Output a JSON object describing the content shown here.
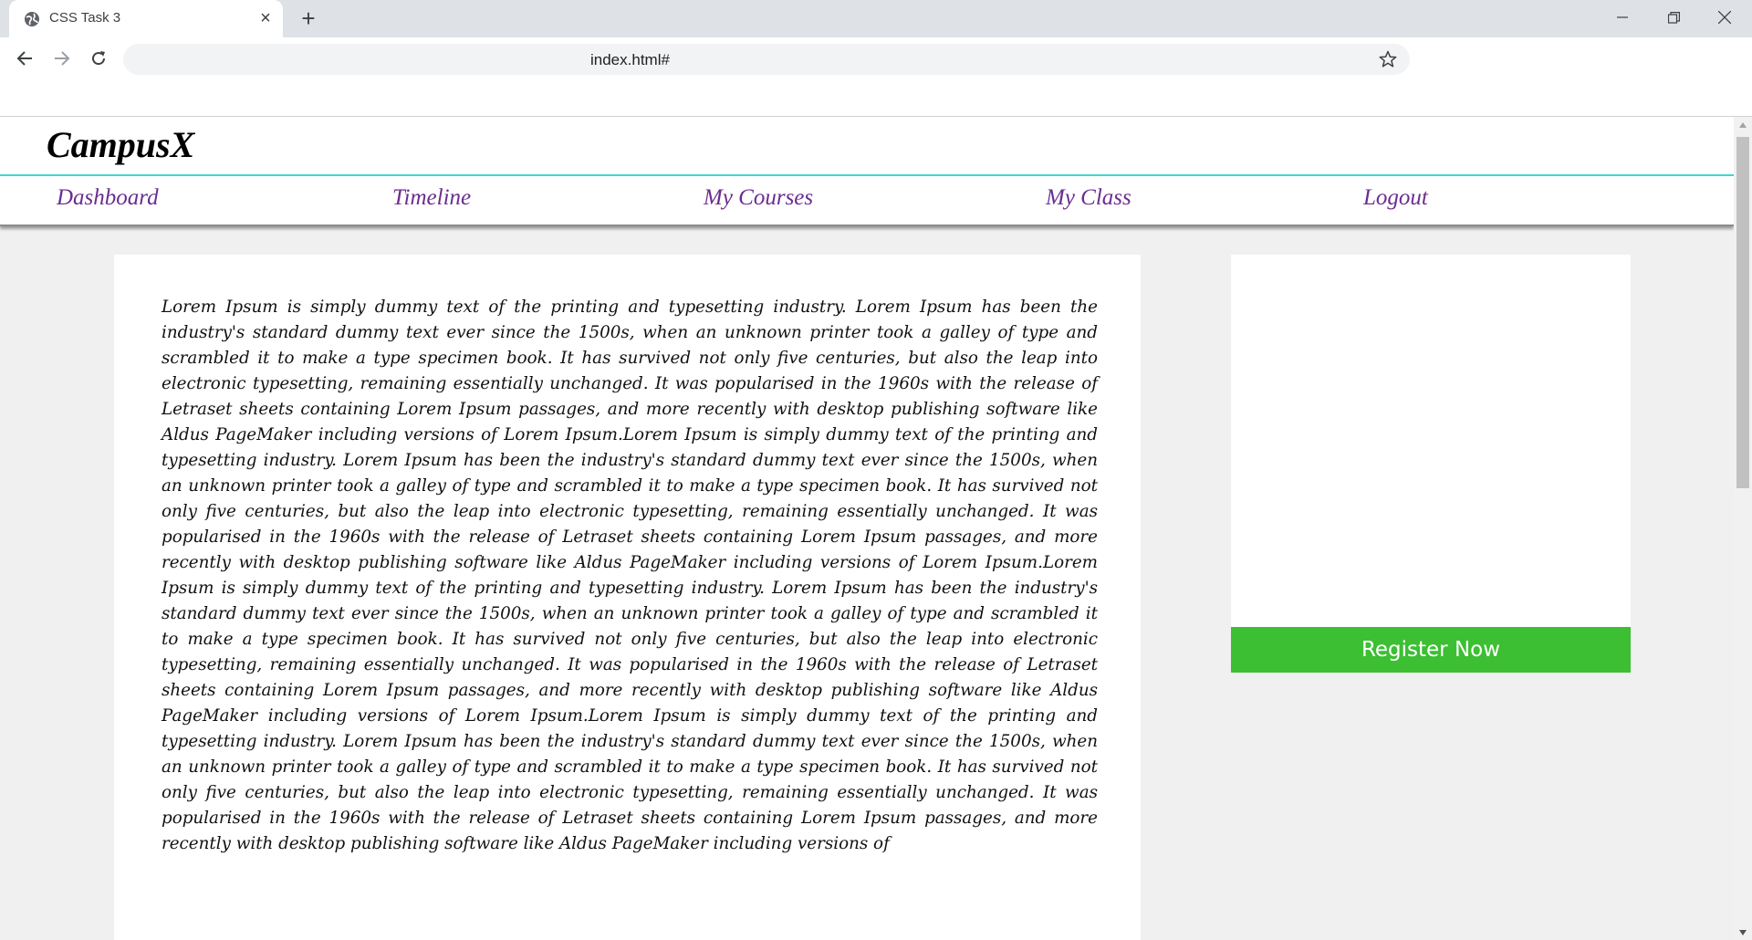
{
  "browser": {
    "tab_title": "CSS Task 3",
    "url": "index.html#",
    "tab_icon": "globe-icon",
    "new_tab_icon": "plus-icon",
    "close_tab_glyph": "×",
    "new_tab_glyph": "+"
  },
  "site": {
    "brand": "CampusX",
    "nav": [
      {
        "label": "Dashboard"
      },
      {
        "label": "Timeline"
      },
      {
        "label": "My Courses"
      },
      {
        "label": "My Class"
      },
      {
        "label": "Logout"
      }
    ],
    "nav_color": "#6b2c91",
    "accent_rule_color": "#3fd6d6"
  },
  "main": {
    "paragraph": "Lorem Ipsum is simply dummy text of the printing and typesetting industry. Lorem Ipsum has been the industry's standard dummy text ever since the 1500s, when an unknown printer took a galley of type and scrambled it to make a type specimen book. It has survived not only five centuries, but also the leap into electronic typesetting, remaining essentially unchanged. It was popularised in the 1960s with the release of Letraset sheets containing Lorem Ipsum passages, and more recently with desktop publishing software like Aldus PageMaker including versions of Lorem Ipsum.Lorem Ipsum is simply dummy text of the printing and typesetting industry. Lorem Ipsum has been the industry's standard dummy text ever since the 1500s, when an unknown printer took a galley of type and scrambled it to make a type specimen book. It has survived not only five centuries, but also the leap into electronic typesetting, remaining essentially unchanged. It was popularised in the 1960s with the release of Letraset sheets containing Lorem Ipsum passages, and more recently with desktop publishing software like Aldus PageMaker including versions of Lorem Ipsum.Lorem Ipsum is simply dummy text of the printing and typesetting industry. Lorem Ipsum has been the industry's standard dummy text ever since the 1500s, when an unknown printer took a galley of type and scrambled it to make a type specimen book. It has survived not only five centuries, but also the leap into electronic typesetting, remaining essentially unchanged. It was popularised in the 1960s with the release of Letraset sheets containing Lorem Ipsum passages, and more recently with desktop publishing software like Aldus PageMaker including versions of Lorem Ipsum.Lorem Ipsum is simply dummy text of the printing and typesetting industry. Lorem Ipsum has been the industry's standard dummy text ever since the 1500s, when an unknown printer took a galley of type and scrambled it to make a type specimen book. It has survived not only five centuries, but also the leap into electronic typesetting, remaining essentially unchanged. It was popularised in the 1960s with the release of Letraset sheets containing Lorem Ipsum passages, and more recently with desktop publishing software like Aldus PageMaker including versions of"
  },
  "sidebar": {
    "register_label": "Register Now",
    "register_color": "#3cbf33"
  }
}
